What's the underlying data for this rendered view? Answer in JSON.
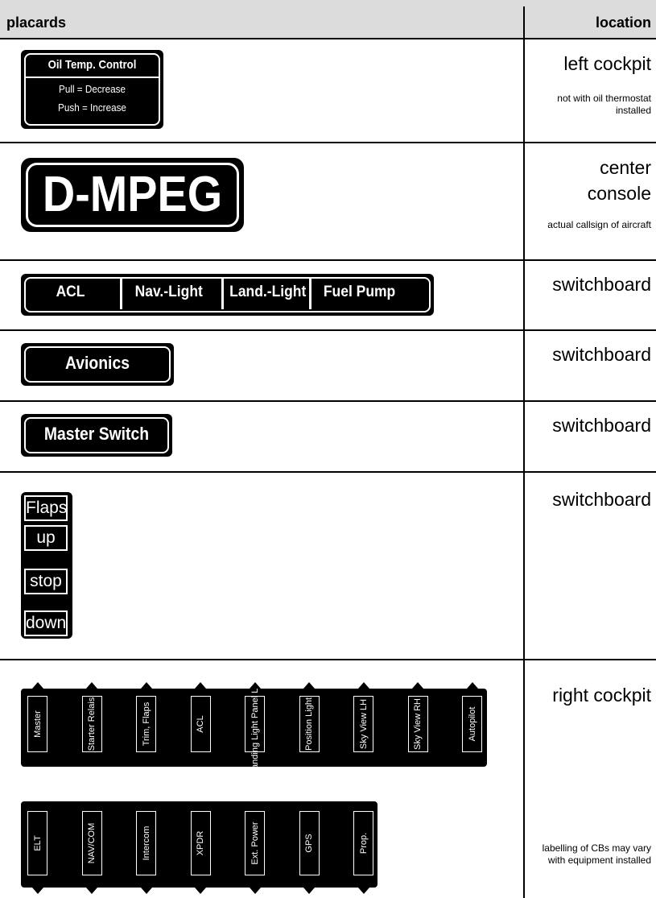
{
  "header": {
    "placards": "placards",
    "location": "location"
  },
  "rows": {
    "oil": {
      "title": "Oil Temp. Control",
      "line1": "Pull = Decrease",
      "line2": "Push = Increase",
      "location": "left cockpit",
      "note": "not with oil thermostat installed"
    },
    "callsign": {
      "text": "D-MPEG",
      "location_l1": "center",
      "location_l2": "console",
      "note": "actual callsign of aircraft"
    },
    "strip": {
      "items": [
        "ACL",
        "Nav.-Light",
        "Land.-Light",
        "Fuel Pump"
      ],
      "location": "switchboard"
    },
    "avionics": {
      "text": "Avionics",
      "location": "switchboard"
    },
    "master": {
      "text": "Master Switch",
      "location": "switchboard"
    },
    "flaps": {
      "items": [
        "Flaps",
        "up",
        "stop",
        "down"
      ],
      "location": "switchboard"
    },
    "cb": {
      "location": "right cockpit",
      "row1": [
        "Master",
        "Starter Relais",
        "Trim, Flaps",
        "ACL",
        "Landing Light Panel Light",
        "Position Light",
        "Sky View LH",
        "Sky View RH",
        "Autopilot"
      ],
      "row2": [
        "ELT",
        "NAV/COM",
        "Intercom",
        "XPDR",
        "Ext. Power",
        "GPS",
        "Prop."
      ],
      "note": "labelling of CBs may vary with equipment installed"
    }
  }
}
